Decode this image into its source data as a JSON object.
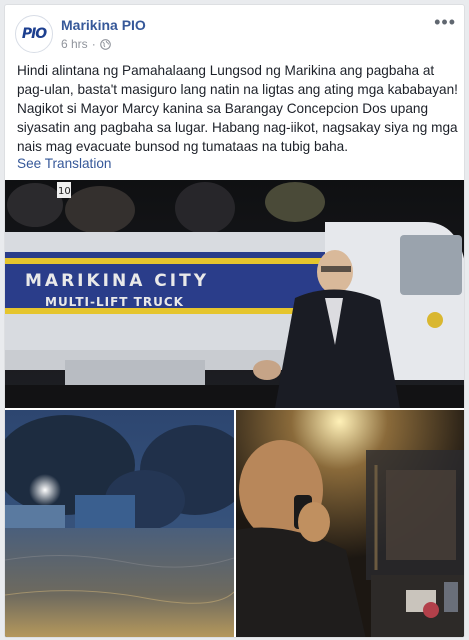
{
  "post": {
    "page_name": "Marikina PIO",
    "avatar_text": "PIO",
    "timestamp": "6 hrs",
    "separator": "·",
    "privacy_icon": "globe-icon",
    "more_icon": "more-horizontal-icon",
    "body": "Hindi alintana ng Pamahalaang Lungsod ng Marikina ang pagbaha at pag-ulan, basta't masiguro lang natin na ligtas ang ating mga kababayan! Nagikot si Mayor Marcy kanina sa Barangay Concepcion Dos upang siyasatin ang pagbaha sa lugar. Habang nag-iikot, nagsakay siya ng mga nais mag evacuate bunsod ng tumataas na tubig baha.",
    "see_translation": "See Translation"
  },
  "photos": {
    "main": {
      "truck_line1": "MARIKINA CITY",
      "truck_line2": "MULTI-LIFT TRUCK",
      "plate_number": "10"
    }
  },
  "colors": {
    "link": "#365899",
    "text": "#1d2129",
    "meta": "#90949c",
    "background": "#e9ebee"
  }
}
